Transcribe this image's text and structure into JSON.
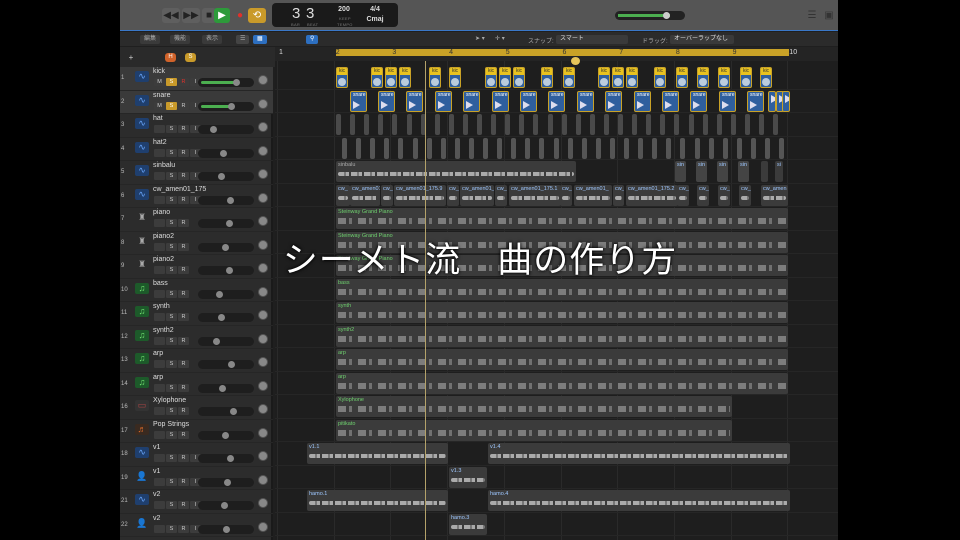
{
  "toolbar": {
    "rewind": "◀◀",
    "forward": "▶▶",
    "stop": "■",
    "play": "▶",
    "record": "●",
    "cycle": "⟲",
    "lcd": {
      "bar": "3",
      "beat": "3",
      "bar_label": "BAR",
      "beat_label": "BEAT",
      "tempo": "200",
      "tempo_mode": "KEEP",
      "tempo_label": "TEMPO",
      "signature": "4/4",
      "key": "Cmaj"
    },
    "master_volume": 0.75
  },
  "toolbar2": {
    "edit": "編集",
    "functions": "機能",
    "view": "表示",
    "snap_label": "スナップ:",
    "snap_value": "スマート",
    "drag_label": "ドラッグ:",
    "drag_value": "オーバーラップなし"
  },
  "header_buttons": {
    "add": "+",
    "hide": "H",
    "solo": "S"
  },
  "ruler": [
    "1",
    "2",
    "3",
    "4",
    "5",
    "6",
    "7",
    "8",
    "9",
    "10"
  ],
  "colors": {
    "accent": "#c9a227",
    "midi": "#6fd16f",
    "audio_region": "#2f5f9e"
  },
  "tracks": [
    {
      "num": "1",
      "name": "kick",
      "icon": "waveform-icon",
      "m": true,
      "solo_on": true,
      "rec_on": true,
      "i": true,
      "vol": 0.72,
      "regions": [
        "kic"
      ]
    },
    {
      "num": "2",
      "name": "snare",
      "icon": "waveform-icon",
      "m": true,
      "solo_on": true,
      "i": true,
      "vol": 0.62,
      "regions": [
        "snare"
      ]
    },
    {
      "num": "3",
      "name": "hat",
      "icon": "waveform-icon",
      "i": true,
      "vol": 0.25,
      "regions": []
    },
    {
      "num": "4",
      "name": "hat2",
      "icon": "waveform-icon",
      "i": true,
      "vol": 0.45,
      "regions": []
    },
    {
      "num": "5",
      "name": "sinbalu",
      "icon": "waveform-icon",
      "i": true,
      "vol": 0.4,
      "regions": [
        "sinbalu",
        "sin",
        "sin",
        "sin",
        "sin",
        "si"
      ]
    },
    {
      "num": "6",
      "name": "cw_amen01_175",
      "icon": "waveform-icon",
      "i": true,
      "vol": 0.6,
      "regions": [
        "cw_",
        "cw_amen01_",
        "cw_",
        "cw_amen01_175.9",
        "cw_",
        "cw_amen01_",
        "cw_",
        "cw_amen01_175.1",
        "cw_",
        "cw_amen01_",
        "cw_",
        "cw_amen01_175.2",
        "cw_",
        "cw_",
        "cw_",
        "cw_",
        "cw_amen"
      ]
    },
    {
      "num": "7",
      "name": "piano",
      "icon": "piano-icon",
      "vol": 0.58,
      "regions": [
        "Steinway Grand Piano"
      ]
    },
    {
      "num": "8",
      "name": "piano2",
      "icon": "piano-icon",
      "vol": 0.48,
      "regions": [
        "Steinway Grand Piano"
      ]
    },
    {
      "num": "9",
      "name": "piano2",
      "icon": "piano-icon",
      "vol": 0.58,
      "regions": [
        "Steinway Grand Piano"
      ]
    },
    {
      "num": "10",
      "name": "bass",
      "icon": "music-note-icon",
      "vol": 0.37,
      "regions": [
        "bass"
      ]
    },
    {
      "num": "11",
      "name": "synth",
      "icon": "music-note-icon",
      "vol": 0.4,
      "regions": [
        "synth"
      ]
    },
    {
      "num": "12",
      "name": "synth2",
      "icon": "music-note-icon",
      "vol": 0.31,
      "regions": [
        "synth2"
      ]
    },
    {
      "num": "13",
      "name": "arp",
      "icon": "music-note-icon",
      "vol": 0.62,
      "regions": [
        "arp"
      ]
    },
    {
      "num": "14",
      "name": "arp",
      "icon": "music-note-icon",
      "vol": 0.42,
      "regions": [
        "arp"
      ]
    },
    {
      "num": "16",
      "name": "Xylophone",
      "icon": "xylophone-icon",
      "vol": 0.65,
      "regions": [
        "Xylophone"
      ]
    },
    {
      "num": "17",
      "name": "Pop Strings",
      "icon": "strings-icon",
      "vol": 0.48,
      "regions": [
        "pitikato"
      ]
    },
    {
      "num": "18",
      "name": "v1",
      "icon": "waveform-icon",
      "i": true,
      "vol": 0.6,
      "regions": [
        "v1.1",
        "v1.4"
      ]
    },
    {
      "num": "19",
      "name": "v1",
      "icon": "user-icon",
      "i": true,
      "vol": 0.53,
      "regions": [
        "v1.3"
      ]
    },
    {
      "num": "21",
      "name": "v2",
      "icon": "waveform-icon",
      "i": true,
      "vol": 0.47,
      "regions": [
        "hamo.1",
        "hamo.4"
      ]
    },
    {
      "num": "22",
      "name": "v2",
      "icon": "user-icon",
      "i": true,
      "vol": 0.51,
      "regions": [
        "hamo.3"
      ]
    }
  ],
  "button_labels": {
    "mute": "M",
    "solo": "S",
    "record": "R",
    "input": "I"
  },
  "overlay_title": "シーメト流　曲の作り方"
}
